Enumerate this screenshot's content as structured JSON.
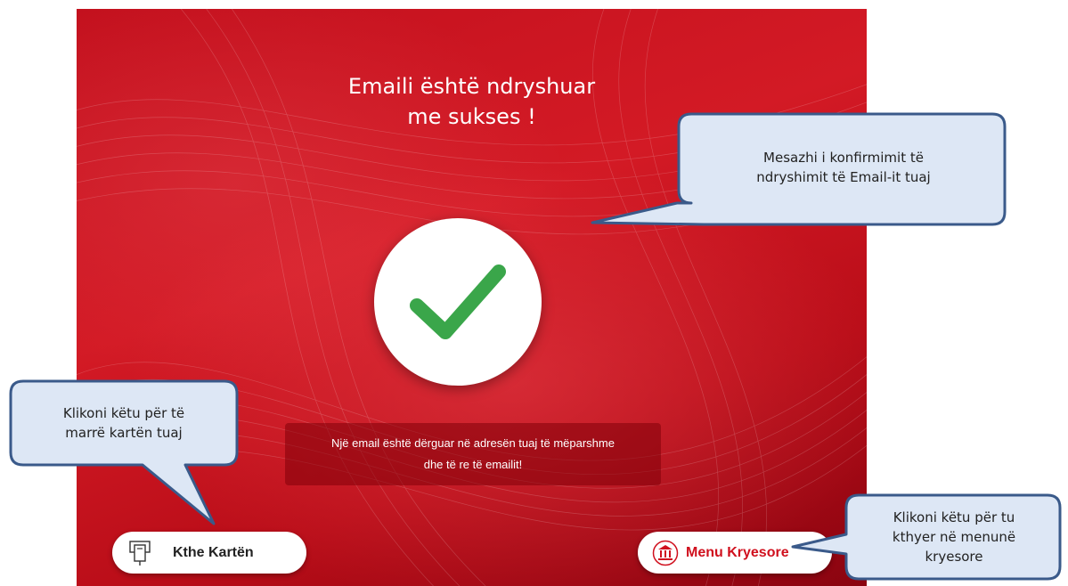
{
  "screen": {
    "title_line1": "Emaili është ndryshuar",
    "title_line2": "me sukses !",
    "notice_line1": "Një email është dërguar në adresën tuaj të mëparshme",
    "notice_line2": "dhe të re të emailit!",
    "back_button_label": "Kthe Kartën",
    "menu_button_label": "Menu Kryesore",
    "success_icon": "checkmark-icon",
    "accent_color": "#d0101e",
    "check_color": "#3aa64a"
  },
  "callouts": {
    "confirm_line1": "Mesazhi i konfirmimit të",
    "confirm_line2": "ndryshimit të Email-it tuaj",
    "card_line1": "Klikoni këtu për të",
    "card_line2": "marrë kartën tuaj",
    "menu_line1": "Klikoni këtu për tu",
    "menu_line2": "kthyer në menunë",
    "menu_line3": "kryesore",
    "fill_color": "#dde7f5",
    "border_color": "#3a5a8a"
  }
}
